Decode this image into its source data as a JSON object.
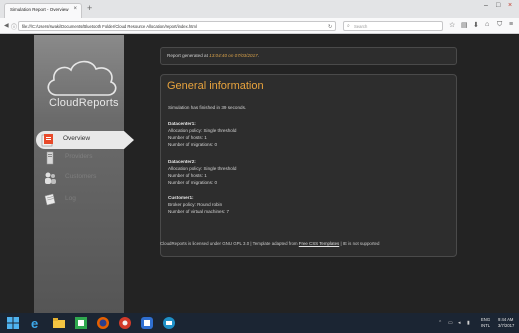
{
  "browser": {
    "tab_title": "Simulation Report - Overview",
    "tab_close": "×",
    "new_tab": "+",
    "url": "file:///C:/Users/swaki/Documents/Bluetooth Folder/Cloud Resource Allocation/report/index.html",
    "search_placeholder": "Search",
    "window_controls": [
      "–",
      "□",
      "×"
    ],
    "toolbar_icons": [
      "star-icon",
      "reader-icon",
      "download-icon",
      "home-icon",
      "shield-icon",
      "menu-icon"
    ]
  },
  "page": {
    "logo": "CloudReports",
    "menu": [
      {
        "label": "Overview",
        "active": true
      },
      {
        "label": "Providers",
        "active": false
      },
      {
        "label": "Customers",
        "active": false
      },
      {
        "label": "Log",
        "active": false
      }
    ],
    "report": {
      "prefix": "Report generated at ",
      "date": "13:04:40 on 07/03/2017",
      "suffix": "."
    },
    "info": {
      "title": "General information",
      "simulation": "Simulation has finished in 39 seconds.",
      "datacenter1": {
        "title": "Datacenter1:",
        "policy": "Allocation policy: Single threshold",
        "hosts": "Number of hosts: 1",
        "migrations": "Number of migrations: 0"
      },
      "datacenter2": {
        "title": "Datacenter2:",
        "policy": "Allocation policy: Single threshold",
        "hosts": "Number of hosts: 1",
        "migrations": "Number of migrations: 0"
      },
      "customer1": {
        "title": "Customer1:",
        "policy": "Broker policy: Round robin",
        "vms": "Number of virtual machines: 7"
      }
    },
    "footer": {
      "before": "CloudReports is licensed under GNU GPL 3.0 | Template adapted from ",
      "link": "Free CSS Templates",
      "after": " | IE is not supported"
    }
  },
  "taskbar": {
    "tray_lang": "ENG\nINTL",
    "time": "9:44 AM",
    "date": "3/7/2017"
  },
  "colors": {
    "accent": "#e8a33d",
    "page_bg": "#232323",
    "taskbar_bg": "#1b2533"
  }
}
